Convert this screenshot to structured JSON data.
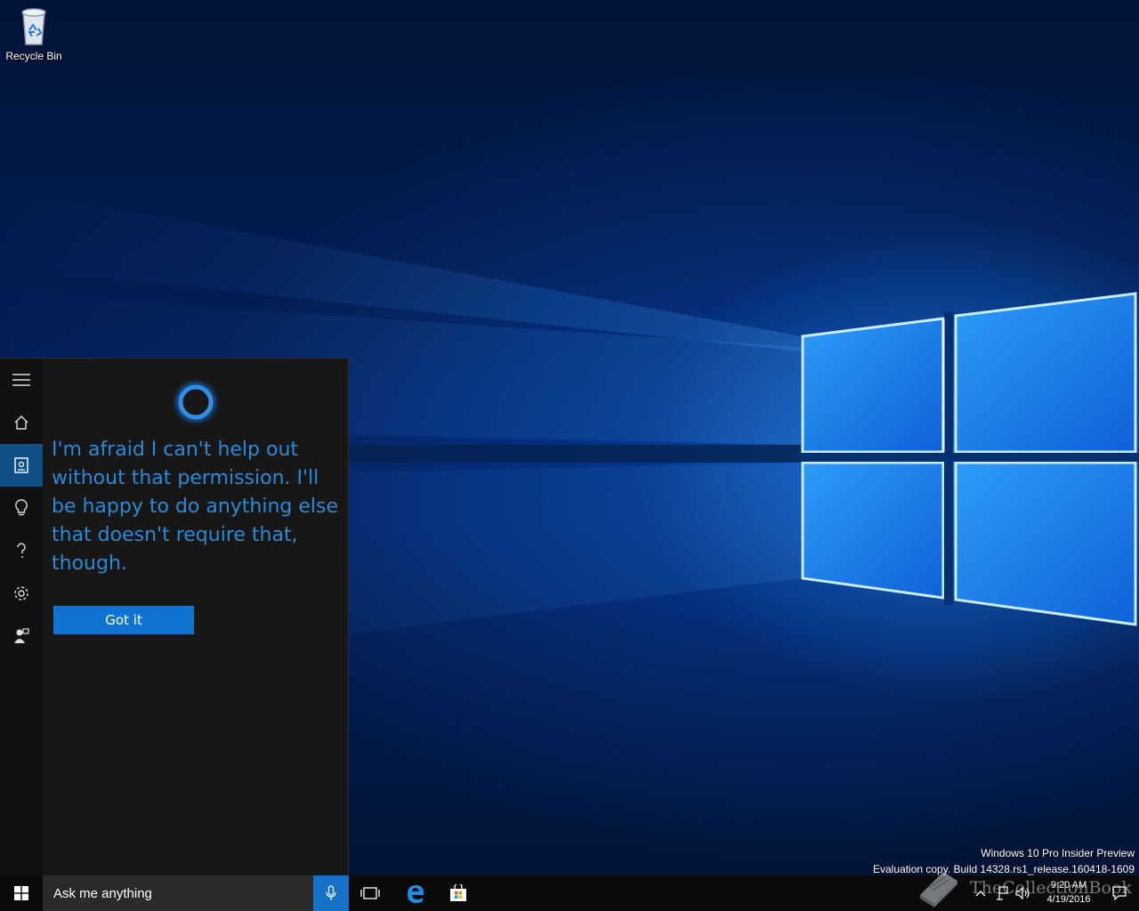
{
  "desktop": {
    "icons": [
      {
        "label": "Recycle Bin"
      }
    ],
    "watermark": {
      "line1": "Windows 10 Pro Insider Preview",
      "line2": "Evaluation copy. Build 14328.rs1_release.160418-1609"
    },
    "overlay_text": "TheCollectionBook"
  },
  "cortana": {
    "rail": [
      {
        "icon": "hamburger-menu-icon"
      },
      {
        "icon": "home-icon"
      },
      {
        "icon": "notebook-icon",
        "active": true
      },
      {
        "icon": "lightbulb-icon"
      },
      {
        "icon": "help-icon"
      },
      {
        "icon": "gear-icon"
      },
      {
        "icon": "feedback-icon"
      }
    ],
    "message": "I'm afraid I can't help out without that permission. I'll be happy to do anything else that doesn't require that, though.",
    "button_label": "Got it",
    "accent": "#0f74d0",
    "text_color": "#2a8ad6"
  },
  "taskbar": {
    "start_icon": "windows-logo-icon",
    "search_placeholder": "Ask me anything",
    "mic_icon": "microphone-icon",
    "pinned": [
      {
        "icon": "task-view-icon"
      },
      {
        "icon": "edge-browser-icon"
      },
      {
        "icon": "store-icon"
      }
    ],
    "tray": {
      "icons": [
        "chevron-up-icon",
        "network-icon",
        "volume-icon"
      ],
      "time": "9:20 AM",
      "date": "4/19/2016",
      "notification_icon": "action-center-icon"
    }
  }
}
